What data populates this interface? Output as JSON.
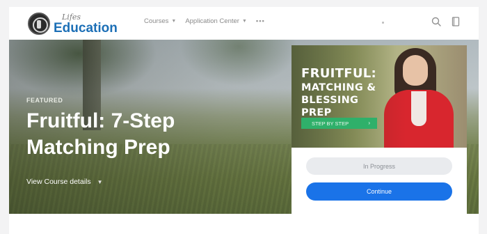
{
  "brand": {
    "logo_small": "Lifes",
    "logo_main": "Education"
  },
  "nav": {
    "items": [
      {
        "label": "Courses"
      },
      {
        "label": "Application Center"
      }
    ],
    "more_label": "•••"
  },
  "hero": {
    "eyebrow": "FEATURED",
    "title": "Fruitful: 7-Step Matching Prep",
    "details_link": "View Course details"
  },
  "course_card": {
    "image_title_line1": "FRUITFUL:",
    "image_title_line2": "MATCHING &",
    "image_title_line3": "BLESSING PREP",
    "image_tag": "STEP BY STEP",
    "status": "In Progress",
    "action": "Continue"
  },
  "colors": {
    "brand_blue": "#1c6fb6",
    "primary_button": "#1a73e8",
    "tag_green": "#2fb06a",
    "jacket_red": "#d8262e"
  },
  "icons": [
    "search-icon",
    "book-icon",
    "chevron-down-icon",
    "arrow-right-icon"
  ]
}
